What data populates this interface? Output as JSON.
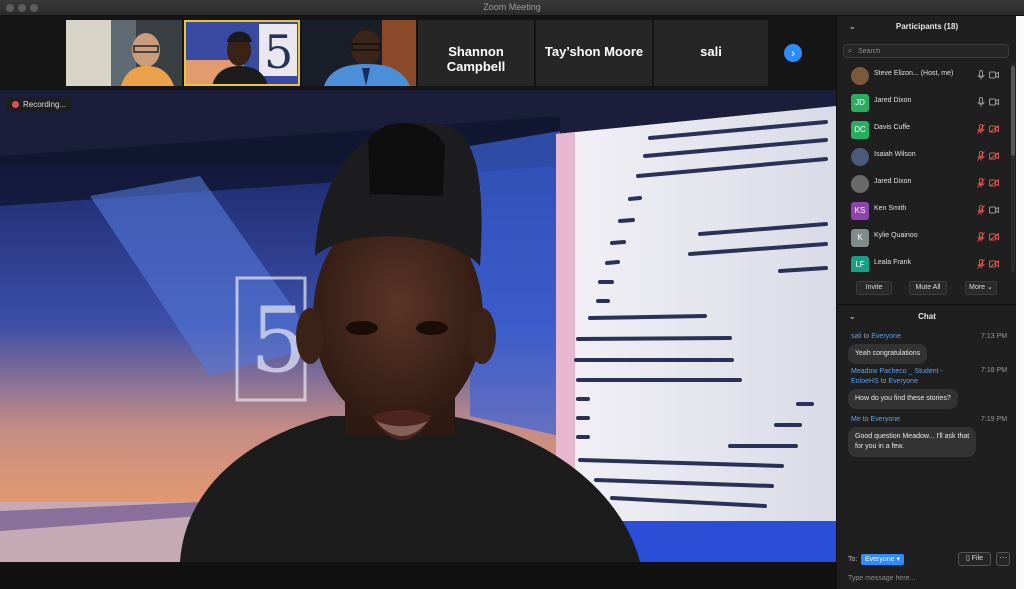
{
  "window": {
    "title": "Zoom Meeting"
  },
  "strip": {
    "tiles": [
      {
        "name": ""
      },
      {
        "name": ""
      },
      {
        "name": ""
      },
      {
        "name": "Shannon Campbell"
      },
      {
        "name": "Tay’shon Moore"
      },
      {
        "name": "sali"
      }
    ],
    "next_icon": "chevron-right-icon"
  },
  "recording": {
    "label": "Recording..."
  },
  "participants": {
    "header": "Participants (18)",
    "search_placeholder": "Search",
    "list": [
      {
        "initials": "",
        "name": "Steve Elizon... (Host, me)",
        "color": "#7a5a3a",
        "muted": false,
        "video_off": false
      },
      {
        "initials": "JD",
        "name": "Jared Dixon",
        "color": "#27ae60",
        "muted": false,
        "video_off": false
      },
      {
        "initials": "DC",
        "name": "Davis Cuffe",
        "color": "#27ae60",
        "muted": true,
        "video_off": true
      },
      {
        "initials": "",
        "name": "Isaiah Wilson",
        "color": "#4a5a7a",
        "muted": true,
        "video_off": true
      },
      {
        "initials": "",
        "name": "Jared Dixon",
        "color": "#6a6a6a",
        "muted": true,
        "video_off": true
      },
      {
        "initials": "KS",
        "name": "Ken Smith",
        "color": "#8e44ad",
        "muted": true,
        "video_off": false
      },
      {
        "initials": "K",
        "name": "Kylie Quainoo",
        "color": "#7f8c8d",
        "muted": true,
        "video_off": true
      },
      {
        "initials": "LF",
        "name": "Leala Frank",
        "color": "#16a085",
        "muted": true,
        "video_off": true
      }
    ],
    "buttons": {
      "invite": "Invite",
      "mute_all": "Mute All",
      "more": "More"
    }
  },
  "chat": {
    "header": "Chat",
    "messages": [
      {
        "from": "sali",
        "to_word": "to",
        "to": "Everyone",
        "time": "7:13 PM",
        "text": "Yeah congratulations"
      },
      {
        "from": "Meadow Pacheco _ Student -",
        "from2": "EnloeHS",
        "to_word": "to",
        "to": "Everyone",
        "time": "7:18 PM",
        "text": "How do you find these stories?"
      },
      {
        "from": "Me",
        "to_word": "to",
        "to": "Everyone",
        "time": "7:19 PM",
        "text1": "Good question Meadow... I'll ask that",
        "text2": "for you in a few."
      }
    ],
    "to_label": "To:",
    "to_value": "Everyone",
    "file_label": "File",
    "more_label": "···",
    "input_placeholder": "Type message here..."
  },
  "colors": {
    "accent": "#2d8cff",
    "active_speaker": "#e8c53b",
    "muted_red": "#e0524f"
  }
}
